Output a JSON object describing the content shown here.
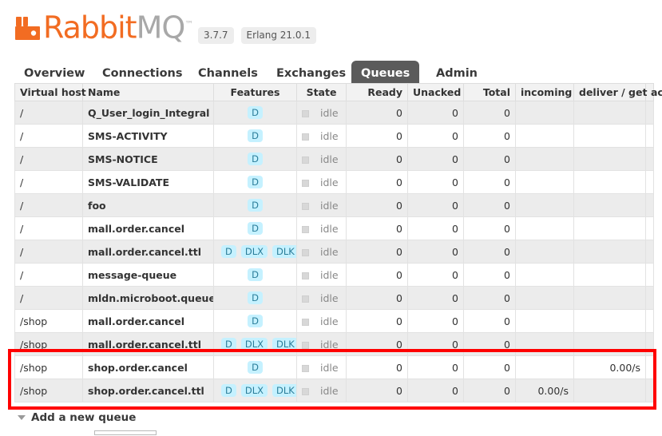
{
  "header": {
    "logo_rabbit": "Rabbit",
    "logo_mq": "MQ",
    "logo_tm": "™",
    "version": "3.7.7",
    "erlang_version": "Erlang 21.0.1"
  },
  "nav": {
    "tabs": [
      {
        "label": "Overview",
        "active": false
      },
      {
        "label": "Connections",
        "active": false
      },
      {
        "label": "Channels",
        "active": false
      },
      {
        "label": "Exchanges",
        "active": false
      },
      {
        "label": "Queues",
        "active": true
      },
      {
        "label": "Admin",
        "active": false
      }
    ]
  },
  "table": {
    "columns": [
      "Virtual host",
      "Name",
      "Features",
      "State",
      "Ready",
      "Unacked",
      "Total",
      "incoming",
      "deliver / get",
      "ac"
    ],
    "rows": [
      {
        "vhost": "/",
        "name": "Q_User_login_Integral",
        "features": [
          "D"
        ],
        "state": "idle",
        "ready": "0",
        "unacked": "0",
        "total": "0",
        "incoming": "",
        "deliver_get": ""
      },
      {
        "vhost": "/",
        "name": "SMS-ACTIVITY",
        "features": [
          "D"
        ],
        "state": "idle",
        "ready": "0",
        "unacked": "0",
        "total": "0",
        "incoming": "",
        "deliver_get": ""
      },
      {
        "vhost": "/",
        "name": "SMS-NOTICE",
        "features": [
          "D"
        ],
        "state": "idle",
        "ready": "0",
        "unacked": "0",
        "total": "0",
        "incoming": "",
        "deliver_get": ""
      },
      {
        "vhost": "/",
        "name": "SMS-VALIDATE",
        "features": [
          "D"
        ],
        "state": "idle",
        "ready": "0",
        "unacked": "0",
        "total": "0",
        "incoming": "",
        "deliver_get": ""
      },
      {
        "vhost": "/",
        "name": "foo",
        "features": [
          "D"
        ],
        "state": "idle",
        "ready": "0",
        "unacked": "0",
        "total": "0",
        "incoming": "",
        "deliver_get": ""
      },
      {
        "vhost": "/",
        "name": "mall.order.cancel",
        "features": [
          "D"
        ],
        "state": "idle",
        "ready": "0",
        "unacked": "0",
        "total": "0",
        "incoming": "",
        "deliver_get": ""
      },
      {
        "vhost": "/",
        "name": "mall.order.cancel.ttl",
        "features": [
          "D",
          "DLX",
          "DLK"
        ],
        "state": "idle",
        "ready": "0",
        "unacked": "0",
        "total": "0",
        "incoming": "",
        "deliver_get": ""
      },
      {
        "vhost": "/",
        "name": "message-queue",
        "features": [
          "D"
        ],
        "state": "idle",
        "ready": "0",
        "unacked": "0",
        "total": "0",
        "incoming": "",
        "deliver_get": ""
      },
      {
        "vhost": "/",
        "name": "mldn.microboot.queue",
        "features": [
          "D"
        ],
        "state": "idle",
        "ready": "0",
        "unacked": "0",
        "total": "0",
        "incoming": "",
        "deliver_get": ""
      },
      {
        "vhost": "/shop",
        "name": "mall.order.cancel",
        "features": [
          "D"
        ],
        "state": "idle",
        "ready": "0",
        "unacked": "0",
        "total": "0",
        "incoming": "",
        "deliver_get": ""
      },
      {
        "vhost": "/shop",
        "name": "mall.order.cancel.ttl",
        "features": [
          "D",
          "DLX",
          "DLK"
        ],
        "state": "idle",
        "ready": "0",
        "unacked": "0",
        "total": "0",
        "incoming": "",
        "deliver_get": ""
      },
      {
        "vhost": "/shop",
        "name": "shop.order.cancel",
        "features": [
          "D"
        ],
        "state": "idle",
        "ready": "0",
        "unacked": "0",
        "total": "0",
        "incoming": "",
        "deliver_get": "0.00/s"
      },
      {
        "vhost": "/shop",
        "name": "shop.order.cancel.ttl",
        "features": [
          "D",
          "DLX",
          "DLK"
        ],
        "state": "idle",
        "ready": "0",
        "unacked": "0",
        "total": "0",
        "incoming": "0.00/s",
        "deliver_get": ""
      }
    ],
    "highlighted_row_names": [
      "shop.order.cancel",
      "shop.order.cancel.ttl"
    ]
  },
  "footer": {
    "add_queue_label": "Add a new queue"
  },
  "colors": {
    "brand_orange": "#f26c22",
    "logo_gray": "#a8a8a8",
    "active_tab_bg": "#5b5b5b",
    "feature_badge_bg": "#c5f1ff",
    "feature_badge_fg": "#2a7d99",
    "highlight_red": "#ff0000",
    "row_alt_bg": "#ececec"
  }
}
